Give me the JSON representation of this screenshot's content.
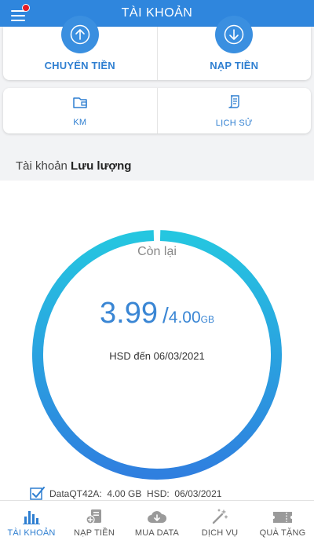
{
  "header": {
    "title": "TÀI KHOẢN"
  },
  "actions": {
    "transfer_label": "CHUYỂN TIỀN",
    "topup_label": "NẠP TIỀN"
  },
  "shortcuts": {
    "promo_label": "KM",
    "history_label": "LỊCH SỬ"
  },
  "account": {
    "prefix": "Tài khoản",
    "type": "Lưu lượng"
  },
  "usage": {
    "remaining_label": "Còn lại",
    "remaining_value": "3.99",
    "separator": "/",
    "total_value": "4.00",
    "unit": "GB",
    "expiry": "HSD đến 06/03/2021",
    "remaining_fraction": 0.9975
  },
  "package": {
    "text": "DataQT42A:  4.00 GB  HSD:  06/03/2021",
    "checked": true
  },
  "tabs": [
    {
      "label": "TÀI KHOẢN",
      "icon": "bar-chart-icon",
      "active": true
    },
    {
      "label": "NẠP TIỀN",
      "icon": "topup-card-icon",
      "active": false
    },
    {
      "label": "MUA DATA",
      "icon": "cloud-download-icon",
      "active": false
    },
    {
      "label": "DỊCH VỤ",
      "icon": "magic-wand-icon",
      "active": false
    },
    {
      "label": "QUÀ TẶNG",
      "icon": "gift-ticket-icon",
      "active": false
    }
  ],
  "colors": {
    "primary": "#2f86dd",
    "ring_start": "#25c6e0",
    "ring_end": "#2f7fdf",
    "badge": "#e31b23",
    "inactive_icon": "#9a9a9a"
  }
}
